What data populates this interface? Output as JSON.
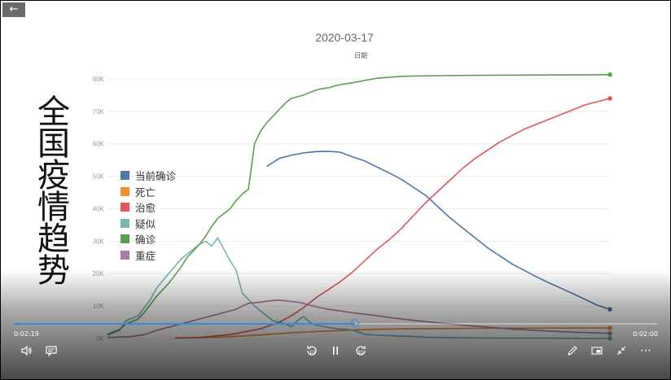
{
  "player": {
    "back_icon": "arrow-left-icon",
    "elapsed": "0:02:19",
    "remaining": "0:02:00",
    "progress_fraction": 0.53,
    "controls": {
      "volume_icon": "speaker-icon",
      "captions_icon": "captions-icon",
      "skip_back_label": "10",
      "pause_icon": "pause-icon",
      "skip_forward_label": "30",
      "edit_icon": "pencil-icon",
      "miniview_icon": "mini-view-icon",
      "collapse_icon": "collapse-icon",
      "more_icon": "more-icon"
    }
  },
  "slide": {
    "title_vertical": [
      "全",
      "国",
      "疫",
      "情",
      "趋",
      "势"
    ]
  },
  "chart_data": {
    "type": "line",
    "title": "2020-03-17",
    "subtitle": "日期",
    "xlabel": "",
    "ylabel": "",
    "ylim": [
      0,
      85000
    ],
    "yticks": [
      0,
      10000,
      20000,
      30000,
      40000,
      50000,
      60000,
      70000,
      80000
    ],
    "ytick_labels": [
      "0K",
      "10K",
      "20K",
      "30K",
      "40K",
      "50K",
      "60K",
      "70K",
      "80K"
    ],
    "x_points": 62,
    "grid": true,
    "legend_position": "left-middle",
    "series": [
      {
        "name": "当前确诊",
        "color": "#4e79a7",
        "points": [
          [
            26,
            53000
          ],
          [
            28,
            55500
          ],
          [
            30,
            56500
          ],
          [
            32,
            57200
          ],
          [
            34,
            57600
          ],
          [
            36,
            57700
          ],
          [
            38,
            57400
          ],
          [
            40,
            56000
          ],
          [
            42,
            54700
          ],
          [
            44,
            52800
          ],
          [
            46,
            51000
          ],
          [
            48,
            49000
          ],
          [
            50,
            46500
          ],
          [
            52,
            44000
          ],
          [
            54,
            40500
          ],
          [
            56,
            37000
          ],
          [
            58,
            34000
          ],
          [
            60,
            31000
          ],
          [
            62,
            28000
          ],
          [
            64,
            25500
          ],
          [
            66,
            23000
          ],
          [
            68,
            21000
          ],
          [
            70,
            19000
          ],
          [
            72,
            17200
          ],
          [
            74,
            15500
          ],
          [
            76,
            13800
          ],
          [
            78,
            12000
          ],
          [
            80,
            10200
          ],
          [
            82,
            9000
          ]
        ]
      },
      {
        "name": "死亡",
        "color": "#f28e2b",
        "points": [
          [
            11,
            170
          ],
          [
            15,
            260
          ],
          [
            20,
            560
          ],
          [
            25,
            1100
          ],
          [
            30,
            1770
          ],
          [
            35,
            2240
          ],
          [
            40,
            2600
          ],
          [
            45,
            2870
          ],
          [
            50,
            2980
          ],
          [
            55,
            3070
          ],
          [
            60,
            3140
          ],
          [
            65,
            3180
          ],
          [
            70,
            3200
          ],
          [
            75,
            3220
          ],
          [
            80,
            3230
          ],
          [
            82,
            3230
          ]
        ]
      },
      {
        "name": "治愈",
        "color": "#e15759",
        "points": [
          [
            11,
            100
          ],
          [
            15,
            300
          ],
          [
            20,
            1200
          ],
          [
            25,
            3000
          ],
          [
            28,
            5000
          ],
          [
            30,
            7000
          ],
          [
            32,
            9500
          ],
          [
            34,
            12500
          ],
          [
            36,
            15000
          ],
          [
            38,
            17500
          ],
          [
            40,
            20500
          ],
          [
            42,
            24000
          ],
          [
            44,
            27500
          ],
          [
            46,
            30500
          ],
          [
            48,
            34000
          ],
          [
            50,
            38000
          ],
          [
            52,
            42000
          ],
          [
            54,
            45500
          ],
          [
            56,
            49000
          ],
          [
            58,
            52500
          ],
          [
            60,
            55500
          ],
          [
            62,
            58000
          ],
          [
            64,
            60500
          ],
          [
            66,
            62500
          ],
          [
            68,
            64500
          ],
          [
            70,
            66000
          ],
          [
            72,
            67500
          ],
          [
            74,
            69000
          ],
          [
            76,
            70500
          ],
          [
            78,
            72000
          ],
          [
            80,
            73000
          ],
          [
            82,
            74000
          ]
        ]
      },
      {
        "name": "疑似",
        "color": "#76b7b2",
        "points": [
          [
            0,
            1000
          ],
          [
            2,
            2500
          ],
          [
            3,
            5500
          ],
          [
            5,
            7000
          ],
          [
            6,
            9500
          ],
          [
            7,
            12000
          ],
          [
            8,
            15500
          ],
          [
            10,
            20000
          ],
          [
            12,
            24500
          ],
          [
            13,
            26000
          ],
          [
            15,
            29000
          ],
          [
            16,
            30000
          ],
          [
            17,
            28500
          ],
          [
            18,
            31000
          ],
          [
            20,
            24000
          ],
          [
            21,
            21000
          ],
          [
            22,
            14000
          ],
          [
            23,
            12000
          ],
          [
            24,
            10000
          ],
          [
            25,
            8500
          ],
          [
            26,
            7000
          ],
          [
            27,
            5500
          ],
          [
            28,
            5000
          ],
          [
            29,
            4500
          ],
          [
            30,
            3600
          ],
          [
            31,
            5500
          ],
          [
            32,
            6800
          ],
          [
            33,
            5000
          ],
          [
            34,
            4100
          ],
          [
            36,
            3400
          ],
          [
            38,
            2900
          ],
          [
            40,
            2600
          ],
          [
            42,
            1300
          ],
          [
            44,
            1000
          ],
          [
            46,
            900
          ],
          [
            48,
            700
          ],
          [
            50,
            600
          ],
          [
            52,
            400
          ],
          [
            54,
            350
          ],
          [
            56,
            300
          ],
          [
            58,
            250
          ],
          [
            60,
            200
          ],
          [
            62,
            150
          ],
          [
            64,
            130
          ],
          [
            66,
            120
          ],
          [
            68,
            110
          ],
          [
            70,
            100
          ],
          [
            72,
            90
          ],
          [
            74,
            80
          ],
          [
            76,
            70
          ],
          [
            78,
            60
          ],
          [
            80,
            50
          ],
          [
            82,
            40
          ]
        ]
      },
      {
        "name": "确诊",
        "color": "#59a14f",
        "points": [
          [
            0,
            1300
          ],
          [
            2,
            2800
          ],
          [
            3,
            4500
          ],
          [
            5,
            6000
          ],
          [
            6,
            8000
          ],
          [
            7,
            10500
          ],
          [
            8,
            13000
          ],
          [
            10,
            17000
          ],
          [
            12,
            22000
          ],
          [
            13,
            25000
          ],
          [
            15,
            29000
          ],
          [
            16,
            31500
          ],
          [
            17,
            34500
          ],
          [
            18,
            37000
          ],
          [
            20,
            40000
          ],
          [
            21,
            42500
          ],
          [
            22,
            44500
          ],
          [
            23,
            46000
          ],
          [
            24,
            60000
          ],
          [
            25,
            64000
          ],
          [
            26,
            66500
          ],
          [
            27,
            68500
          ],
          [
            28,
            70500
          ],
          [
            29,
            72500
          ],
          [
            30,
            74000
          ],
          [
            31,
            74500
          ],
          [
            32,
            75000
          ],
          [
            33,
            75800
          ],
          [
            34,
            76500
          ],
          [
            35,
            77000
          ],
          [
            36,
            77200
          ],
          [
            37,
            77800
          ],
          [
            38,
            78200
          ],
          [
            40,
            78800
          ],
          [
            42,
            79500
          ],
          [
            44,
            80200
          ],
          [
            46,
            80500
          ],
          [
            48,
            80800
          ],
          [
            50,
            80900
          ],
          [
            54,
            81000
          ],
          [
            60,
            81100
          ],
          [
            70,
            81200
          ],
          [
            82,
            81300
          ]
        ]
      },
      {
        "name": "重症",
        "color": "#b07aa1",
        "points": [
          [
            0,
            300
          ],
          [
            4,
            600
          ],
          [
            6,
            1200
          ],
          [
            8,
            2500
          ],
          [
            10,
            3500
          ],
          [
            12,
            4500
          ],
          [
            14,
            5500
          ],
          [
            16,
            6500
          ],
          [
            18,
            7500
          ],
          [
            20,
            8500
          ],
          [
            21,
            9000
          ],
          [
            22,
            10000
          ],
          [
            23,
            10800
          ],
          [
            24,
            11000
          ],
          [
            25,
            11200
          ],
          [
            26,
            11500
          ],
          [
            27,
            11700
          ],
          [
            28,
            11800
          ],
          [
            29,
            11600
          ],
          [
            30,
            11400
          ],
          [
            31,
            11200
          ],
          [
            32,
            10800
          ],
          [
            33,
            10300
          ],
          [
            34,
            9800
          ],
          [
            36,
            9000
          ],
          [
            38,
            8500
          ],
          [
            40,
            7900
          ],
          [
            42,
            7500
          ],
          [
            44,
            7000
          ],
          [
            46,
            6500
          ],
          [
            48,
            6000
          ],
          [
            50,
            5600
          ],
          [
            52,
            5200
          ],
          [
            54,
            4800
          ],
          [
            56,
            4500
          ],
          [
            58,
            4100
          ],
          [
            60,
            3800
          ],
          [
            62,
            3500
          ],
          [
            64,
            3200
          ],
          [
            66,
            2900
          ],
          [
            68,
            2700
          ],
          [
            70,
            2500
          ],
          [
            72,
            2300
          ],
          [
            74,
            2100
          ],
          [
            76,
            1950
          ],
          [
            78,
            1830
          ],
          [
            80,
            1700
          ],
          [
            82,
            1600
          ]
        ]
      }
    ]
  }
}
